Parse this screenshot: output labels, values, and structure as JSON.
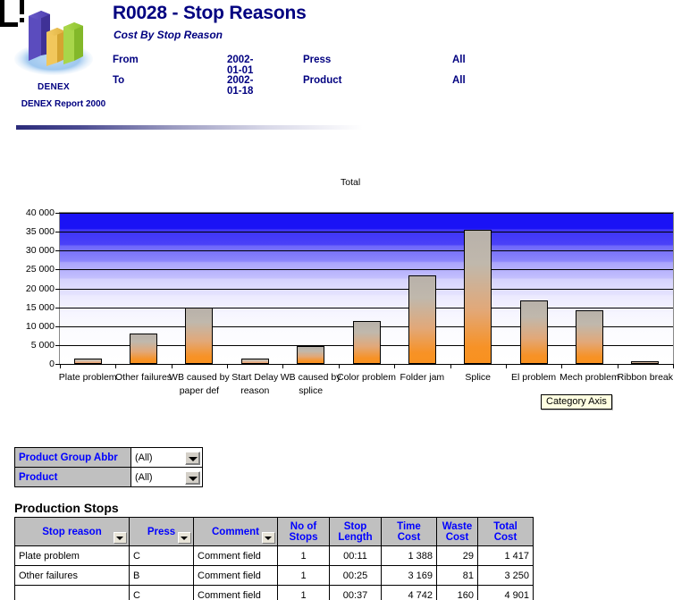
{
  "logo": {
    "name": "DENEX",
    "subtitle": "DENEX Report 2000",
    "icon": "3d-bar-chart-logo"
  },
  "header": {
    "title": "R0028 - Stop Reasons",
    "subtitle": "Cost By Stop Reason",
    "rows": [
      {
        "label": "From",
        "value": "2002-01-01",
        "key": "Press",
        "key_value": "All"
      },
      {
        "label": "To",
        "value": "2002-01-18",
        "key": "Product",
        "key_value": "All"
      }
    ]
  },
  "chart_data": {
    "type": "bar",
    "title": "Total",
    "xlabel": "",
    "ylabel": "",
    "ylim": [
      0,
      40000
    ],
    "yticks": [
      "0",
      "5 000",
      "10 000",
      "15 000",
      "20 000",
      "25 000",
      "30 000",
      "35 000",
      "40 000"
    ],
    "ytick_values": [
      0,
      5000,
      10000,
      15000,
      20000,
      25000,
      30000,
      35000,
      40000
    ],
    "grid": true,
    "legend_position": "top-center",
    "categories": [
      "Plate problem",
      "Other failures",
      "WB caused by paper def",
      "Start Delay reason",
      "WB caused by splice",
      "Color problem",
      "Folder jam",
      "Splice",
      "El problem",
      "Mech problem",
      "Ribbon break"
    ],
    "values": [
      1417,
      8000,
      15000,
      1400,
      4800,
      11300,
      23500,
      35400,
      16800,
      14300,
      700
    ],
    "series": [
      {
        "name": "Total",
        "values": [
          1417,
          8000,
          15000,
          1400,
          4800,
          11300,
          23500,
          35400,
          16800,
          14300,
          700
        ]
      }
    ],
    "annotations": [
      {
        "text": "Category Axis",
        "kind": "tooltip"
      }
    ]
  },
  "filters": {
    "rows": [
      {
        "label": "Product Group Abbr",
        "value": "(All)"
      },
      {
        "label": "Product",
        "value": "(All)"
      }
    ]
  },
  "production_stops": {
    "title": "Production Stops",
    "columns": [
      {
        "label": "Stop reason",
        "filterable": true
      },
      {
        "label": "Press",
        "filterable": true
      },
      {
        "label": "Comment",
        "filterable": true
      },
      {
        "label": "No of Stops",
        "filterable": false
      },
      {
        "label": "Stop Length",
        "filterable": false
      },
      {
        "label": "Time Cost",
        "filterable": false
      },
      {
        "label": "Waste Cost",
        "filterable": false
      },
      {
        "label": "Total Cost",
        "filterable": false
      }
    ],
    "rows": [
      {
        "stop_reason": "Plate problem",
        "press": "C",
        "comment": "Comment field",
        "no_of_stops": "1",
        "stop_length": "00:11",
        "time_cost": "1 388",
        "waste_cost": "29",
        "total_cost": "1 417"
      },
      {
        "stop_reason": "Other failures",
        "press": "B",
        "comment": "Comment field",
        "no_of_stops": "1",
        "stop_length": "00:25",
        "time_cost": "3 169",
        "waste_cost": "81",
        "total_cost": "3 250"
      },
      {
        "stop_reason": "",
        "press": "C",
        "comment": "Comment field",
        "no_of_stops": "1",
        "stop_length": "00:37",
        "time_cost": "4 742",
        "waste_cost": "160",
        "total_cost": "4 901"
      }
    ]
  },
  "colors": {
    "brand_navy": "#000080",
    "header_blue": "#0000ff",
    "header_grey": "#c0c0c0",
    "bar_orange": "#f79226",
    "bar_grey": "#b8b1aa",
    "plot_blue": "#1a12f5"
  }
}
